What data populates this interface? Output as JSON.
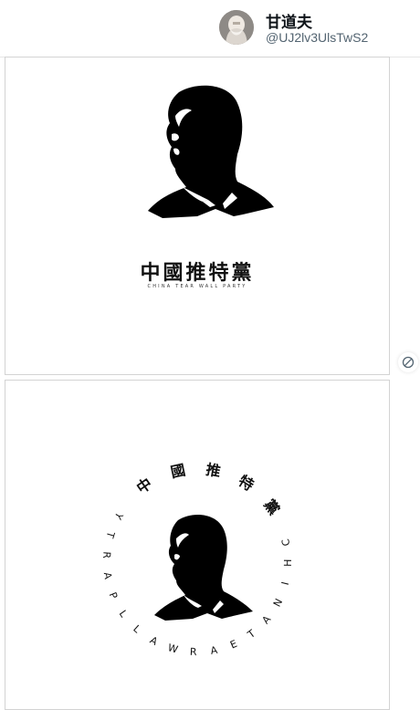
{
  "profile": {
    "display_name": "甘道夫",
    "handle": "@UJ2lv3UlsTwS2",
    "avatar_icon": "avatar-portrait"
  },
  "images": [
    {
      "title": "中國推特黨",
      "subtitle": "CHINA TEAR WALL PARTY"
    },
    {
      "ring_chinese": [
        "中",
        "國",
        "推",
        "特",
        "黨"
      ],
      "ring_latin": "CHINA TEAR WALL PARTY"
    }
  ],
  "overlay": {
    "icon": "block-icon"
  }
}
